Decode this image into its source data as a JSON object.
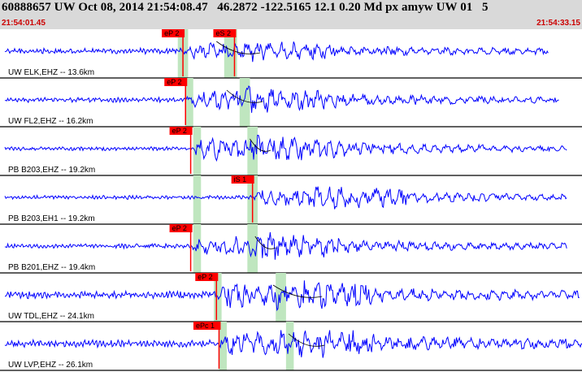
{
  "header": {
    "title": "60888657 UW Oct 08, 2014 21:54:08.47   46.2872 -122.5165 12.1 0.20 Md px amyw UW 01   5",
    "time_start": "21:54:01.45",
    "time_end": "21:54:33.15"
  },
  "colors": {
    "background": "#ffffff",
    "header_bg": "#d9d9d9",
    "trace": "#0000ff",
    "pick_bg": "#ff0000",
    "window": "#bfe6bf",
    "time_text": "#cc0000",
    "divider": "#000000"
  },
  "traces": [
    {
      "label": "UW ELK,EHZ -- 13.6km",
      "picks": [
        {
          "label": "eP 2",
          "t": 7.1
        },
        {
          "label": "eS 2",
          "t": 9.1
        }
      ],
      "windows": [
        {
          "t0": 6.9,
          "t1": 7.3
        },
        {
          "t0": 8.7,
          "t1": 9.2
        }
      ],
      "curve_t": [
        8.4,
        10.1
      ],
      "amp": 0.28,
      "noise": 0.12,
      "end_t": 21.3,
      "seed": 1
    },
    {
      "label": "UW FL2,EHZ -- 16.2km",
      "picks": [
        {
          "label": "eP 2",
          "t": 7.2
        }
      ],
      "windows": [
        {
          "t0": 7.2,
          "t1": 7.5
        },
        {
          "t0": 9.3,
          "t1": 9.7
        }
      ],
      "curve_t": [
        8.8,
        10.2
      ],
      "amp": 0.4,
      "noise": 0.1,
      "end_t": 21.7,
      "seed": 2
    },
    {
      "label": "PB B203,EHZ -- 19.2km",
      "picks": [
        {
          "label": "eP 2",
          "t": 7.4
        }
      ],
      "windows": [
        {
          "t0": 7.5,
          "t1": 7.8
        },
        {
          "t0": 9.6,
          "t1": 10.0
        }
      ],
      "curve_t": [
        9.7,
        10.5
      ],
      "amp": 0.45,
      "noise": 0.08,
      "end_t": 22.0,
      "seed": 3
    },
    {
      "label": "PB B203,EH1 -- 19.2km",
      "picks": [
        {
          "label": "iS 1",
          "t": 9.8
        }
      ],
      "windows": [
        {
          "t0": 7.5,
          "t1": 7.8
        },
        {
          "t0": 9.6,
          "t1": 10.0
        }
      ],
      "curve_t": [],
      "amp": 0.4,
      "noise": 0.08,
      "end_t": 22.0,
      "seed": 4
    },
    {
      "label": "PB B201,EHZ -- 19.4km",
      "picks": [
        {
          "label": "eP 2",
          "t": 7.4
        }
      ],
      "windows": [
        {
          "t0": 7.5,
          "t1": 7.8
        },
        {
          "t0": 9.6,
          "t1": 10.0
        }
      ],
      "curve_t": [
        9.9,
        10.7
      ],
      "amp": 0.45,
      "noise": 0.09,
      "end_t": 22.0,
      "seed": 5
    },
    {
      "label": "UW TDL,EHZ -- 24.1km",
      "picks": [
        {
          "label": "eP 2",
          "t": 8.4
        }
      ],
      "windows": [
        {
          "t0": 8.3,
          "t1": 8.6
        },
        {
          "t0": 10.7,
          "t1": 11.1
        }
      ],
      "curve_t": [
        10.6,
        12.5
      ],
      "amp": 0.45,
      "noise": 0.15,
      "end_t": 22.5,
      "seed": 6
    },
    {
      "label": "UW LVP,EHZ -- 26.1km",
      "picks": [
        {
          "label": "ePc 1",
          "t": 8.5
        }
      ],
      "windows": [
        {
          "t0": 8.5,
          "t1": 8.8
        },
        {
          "t0": 11.1,
          "t1": 11.4
        }
      ],
      "curve_t": [
        11.2,
        12.6
      ],
      "amp": 0.5,
      "noise": 0.15,
      "end_t": 22.7,
      "seed": 7
    }
  ]
}
